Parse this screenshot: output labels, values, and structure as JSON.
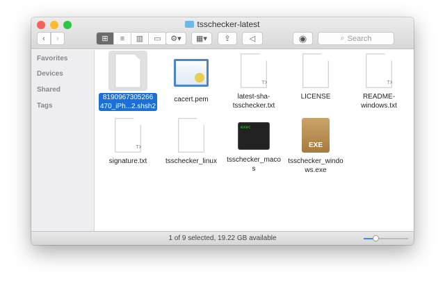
{
  "window": {
    "title": "tsschecker-latest"
  },
  "toolbar": {
    "back": "‹",
    "forward": "›",
    "search_placeholder": "Search"
  },
  "sidebar": {
    "items": [
      "Favorites",
      "Devices",
      "Shared",
      "Tags"
    ]
  },
  "files": [
    {
      "name": "8190967305266470_iPh...2.shsh2",
      "line1": "8190967305266",
      "line2": "470_iPh...2.shsh2",
      "selected": true
    },
    {
      "name": "cacert.pem",
      "line1": "cacert.pem",
      "line2": ""
    },
    {
      "name": "latest-sha-tsschecker.txt",
      "line1": "latest-sha-",
      "line2": "tsschecker.txt",
      "badge": "TXT"
    },
    {
      "name": "LICENSE",
      "line1": "LICENSE",
      "line2": ""
    },
    {
      "name": "README-windows.txt",
      "line1": "README-",
      "line2": "windows.txt",
      "badge": "TXT"
    },
    {
      "name": "signature.txt",
      "line1": "signature.txt",
      "line2": "",
      "badge": "TXT"
    },
    {
      "name": "tsschecker_linux",
      "line1": "tsschecker_linux",
      "line2": ""
    },
    {
      "name": "tsschecker_macos",
      "line1": "tsschecker_maco",
      "line2": "s",
      "exec": "exec"
    },
    {
      "name": "tsschecker_windows.exe",
      "line1": "tsschecker_windo",
      "line2": "ws.exe",
      "exe": "EXE"
    }
  ],
  "status": {
    "text": "1 of 9 selected, 19.22 GB available",
    "icon_size": 0.25
  },
  "colors": {
    "selection": "#1b6fd6",
    "accent": "#3b8cf5"
  }
}
